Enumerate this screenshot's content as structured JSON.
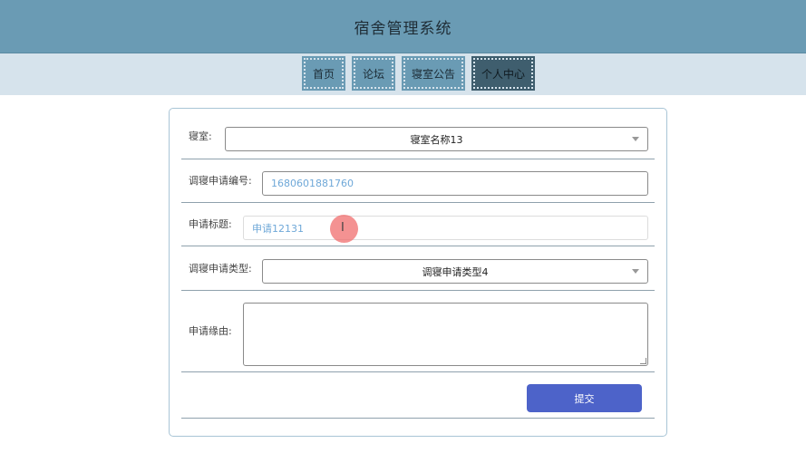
{
  "header": {
    "title": "宿舍管理系统"
  },
  "nav": {
    "items": [
      {
        "label": "首页"
      },
      {
        "label": "论坛"
      },
      {
        "label": "寝室公告"
      },
      {
        "label": "个人中心"
      }
    ],
    "active_index": 3
  },
  "form": {
    "dorm": {
      "label": "寝室:",
      "value": "寝室名称13"
    },
    "apply_no": {
      "label": "调寝申请编号:",
      "value": "1680601881760"
    },
    "apply_title": {
      "label": "申请标题:",
      "value": "申请12131"
    },
    "apply_type": {
      "label": "调寝申请类型:",
      "value": "调寝申请类型4"
    },
    "reason": {
      "label": "申请缘由:",
      "value": ""
    },
    "submit_label": "提交"
  },
  "colors": {
    "header_bg": "#6a9bb4",
    "nav_bg": "#d6e3ec",
    "nav_active": "#3f5e6e",
    "submit_bg": "#4d63c9",
    "input_text": "#6fa8d8"
  }
}
